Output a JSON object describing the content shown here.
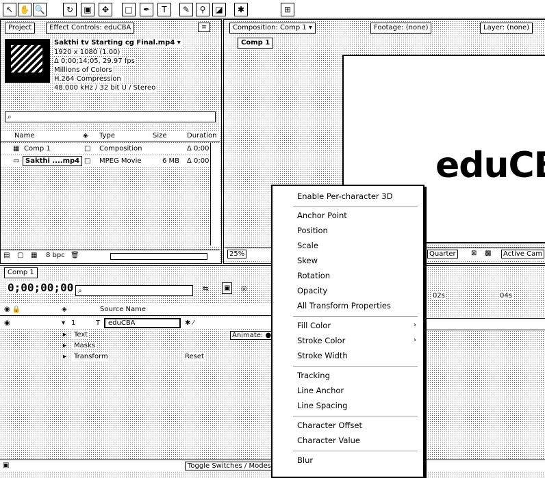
{
  "toolbar": {
    "icons": [
      "select-icon",
      "hand-icon",
      "zoom-icon",
      "rotate-icon",
      "camera-icon",
      "pan-icon",
      "mask-icon",
      "pen-icon",
      "text-icon",
      "brush-icon",
      "stamp-icon",
      "eraser-icon",
      "puppet-icon"
    ]
  },
  "project_panel": {
    "tab_project": "Project",
    "tab_effects": "Effect Controls: eduCBA",
    "asset_name": "Sakthi tv Starting cg Final.mp4 ▾",
    "asset_info": [
      "1920 x 1080 (1.00)",
      "Δ 0;00;14;05, 29.97 fps",
      "Millions of Colors",
      "H.264 Compression",
      "48.000 kHz / 32 bit U / Stereo"
    ],
    "search_placeholder": "",
    "columns": [
      "Name",
      "Type",
      "Size",
      "Duration"
    ],
    "items": [
      {
        "name": "Comp 1",
        "type": "Composition",
        "duration": "Δ 0;00"
      },
      {
        "name": "Sakthi ....mp4",
        "type": "MPEG Movie",
        "size": "6 MB",
        "duration": "Δ 0;00"
      }
    ],
    "bpc": "8 bpc"
  },
  "comp_viewer": {
    "tab_composition": "Composition: Comp 1 ▾",
    "tab_footage": "Footage: (none)",
    "tab_layer": "Layer: (none)",
    "comp_tab": "Comp 1",
    "canvas_text": "eduCB",
    "zoom": "25%",
    "resolution": "Quarter",
    "camera": "Active Cam"
  },
  "timeline": {
    "tab": "Comp 1",
    "timecode": "0;00;00;00",
    "source_name_header": "Source Name",
    "layer_name": "eduCBA",
    "layer_num": "1",
    "props": [
      "Text",
      "Masks",
      "Transform"
    ],
    "animate_label": "Animate: ●",
    "reset_label": "Reset",
    "marker_1": "02s",
    "marker_2": "04s",
    "footer": "Toggle Switches / Modes"
  },
  "context_menu": {
    "groups": [
      [
        "Enable Per-character 3D"
      ],
      [
        "Anchor Point",
        "Position",
        "Scale",
        "Skew",
        "Rotation",
        "Opacity",
        "All Transform Properties"
      ],
      [
        "Fill Color",
        "Stroke Color",
        "Stroke Width"
      ],
      [
        "Tracking",
        "Line Anchor",
        "Line Spacing"
      ],
      [
        "Character Offset",
        "Character Value"
      ],
      [
        "Blur"
      ]
    ],
    "submenu_items": [
      "Fill Color",
      "Stroke Color"
    ]
  }
}
